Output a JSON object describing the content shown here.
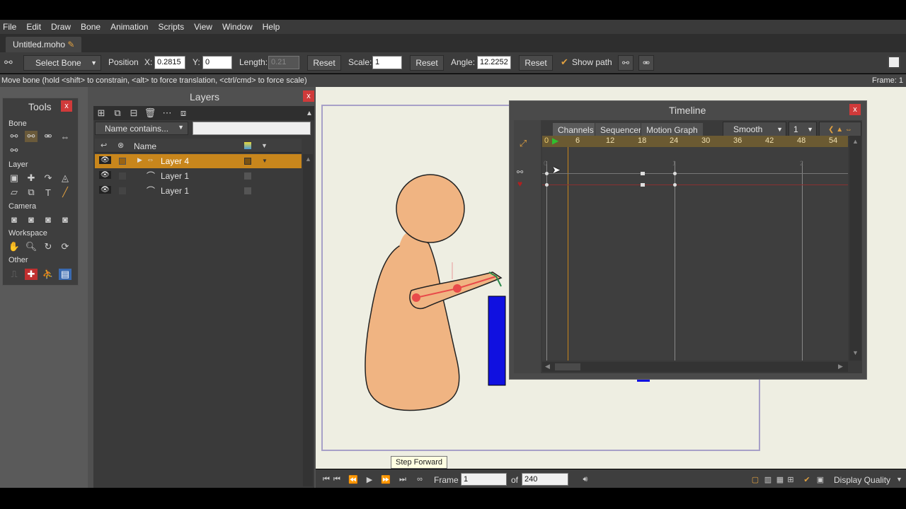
{
  "menu": [
    "File",
    "Edit",
    "Draw",
    "Bone",
    "Animation",
    "Scripts",
    "View",
    "Window",
    "Help"
  ],
  "document_tab": "Untitled.moho",
  "tool_options": {
    "tool_select": "Select Bone",
    "position_label": "Position",
    "x_label": "X:",
    "x_value": "0.2815",
    "y_label": "Y:",
    "y_value": "0",
    "length_label": "Length:",
    "length_value": "0.21",
    "reset1": "Reset",
    "scale_label": "Scale:",
    "scale_value": "1",
    "reset2": "Reset",
    "angle_label": "Angle:",
    "angle_value": "12.2252",
    "reset3": "Reset",
    "show_path_label": "Show path",
    "show_path_checked": true
  },
  "status": {
    "message": "Move bone (hold <shift> to constrain, <alt> to force translation, <ctrl/cmd> to force scale)",
    "frame": "Frame: 1"
  },
  "tools_panel": {
    "title": "Tools",
    "close": "x",
    "sections": [
      "Bone",
      "Layer",
      "Camera",
      "Workspace",
      "Other"
    ]
  },
  "layers_panel": {
    "title": "Layers",
    "close": "x",
    "filter_mode": "Name contains...",
    "filter_text": "",
    "column_name": "Name",
    "rows": [
      {
        "name": "Layer 4",
        "selected": true
      },
      {
        "name": "Layer 1",
        "selected": false
      },
      {
        "name": "Layer 1",
        "selected": false
      }
    ]
  },
  "timeline": {
    "title": "Timeline",
    "close": "x",
    "tabs": [
      "Channels",
      "Sequencer",
      "Motion Graph"
    ],
    "interpolation": "Smooth",
    "step_value": "1",
    "ruler": [
      "0",
      "6",
      "12",
      "18",
      "24",
      "30",
      "36",
      "42",
      "48",
      "54"
    ],
    "markers": [
      "0",
      "1",
      "2"
    ]
  },
  "tooltip": "Step Forward",
  "playback": {
    "frame_label": "Frame",
    "frame_value": "1",
    "of_label": "of",
    "total_frames": "240",
    "display_quality": "Display Quality"
  },
  "colors": {
    "accent_selected": "#c8861c",
    "character_skin": "#f0b482",
    "box_blue": "#1010e0",
    "bone_red": "#e84a4a"
  }
}
